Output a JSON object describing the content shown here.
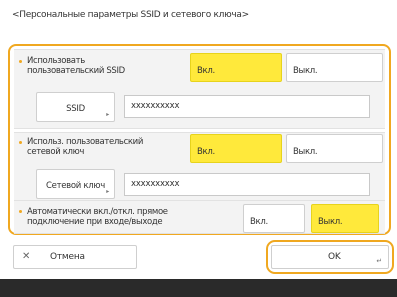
{
  "header": {
    "title": "<Персональные параметры SSID и сетевого ключа>"
  },
  "section1": {
    "label_line1": "Использовать",
    "label_line2": "пользовательский SSID",
    "on_label": "Вкл.",
    "off_label": "Выкл.",
    "key_button": "SSID",
    "value": "xxxxxxxxxx"
  },
  "section2": {
    "label_line1": "Использ. пользовательский",
    "label_line2": "сетевой ключ",
    "on_label": "Вкл.",
    "off_label": "Выкл.",
    "key_button": "Сетевой ключ",
    "value": "xxxxxxxxxx"
  },
  "section3": {
    "label_line1": "Автоматически вкл./откл. прямое",
    "label_line2": "подключение при входе/выходе",
    "on_label": "Вкл.",
    "off_label": "Выкл."
  },
  "footer": {
    "cancel_label": "Отмена",
    "ok_label": "OK"
  },
  "states": {
    "section1": "on",
    "section2": "on",
    "section3": "off"
  },
  "colors": {
    "accent": "#f0a820",
    "selected": "#ffe93b"
  }
}
